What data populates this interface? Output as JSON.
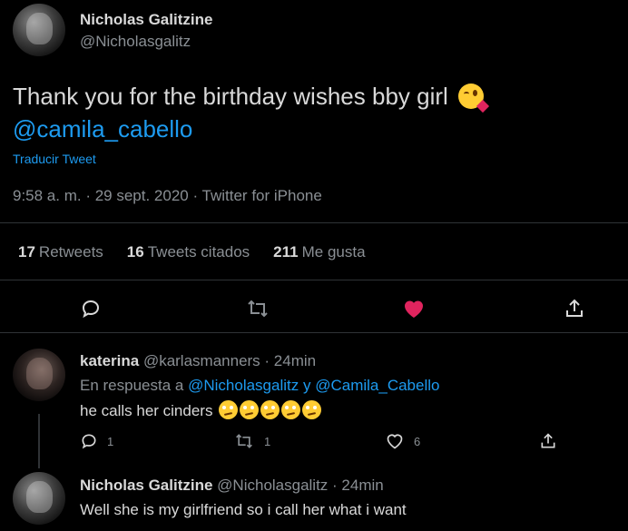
{
  "tweet": {
    "author_name": "Nicholas Galitzine",
    "author_handle": "@Nicholasgalitz",
    "text": "Thank you for the birthday wishes bby girl",
    "mention": "@camila_cabello",
    "emoji": "face-blowing-a-kiss",
    "translate_label": "Traducir Tweet",
    "timestamp": "9:58 a. m. · 29 sept. 2020 · Twitter for iPhone",
    "stats": {
      "retweets_count": "17",
      "retweets_label": "Retweets",
      "quotes_count": "16",
      "quotes_label": "Tweets citados",
      "likes_count": "211",
      "likes_label": "Me gusta"
    },
    "actions": [
      "reply-icon",
      "retweet-icon",
      "like-icon",
      "share-icon"
    ],
    "liked": true,
    "like_color": "#e0245e"
  },
  "replies": [
    {
      "author_name": "katerina",
      "author_handle": "@karlasmanners",
      "time": "· 24min",
      "in_reply_prefix": "En respuesta a",
      "in_reply_user1": "@Nicholasgalitz",
      "in_reply_and": "y",
      "in_reply_user2": "@Camila_Cabello",
      "text": "he calls her cinders",
      "emoji": "face-with-rolling-eyes",
      "emoji_count": 5,
      "reply_count": "1",
      "retweet_count": "1",
      "like_count": "6"
    },
    {
      "author_name": "Nicholas Galitzine",
      "author_handle": "@Nicholasgalitz",
      "time": "· 24min",
      "text": "Well she is my girlfriend so i call her what i want"
    }
  ],
  "colors": {
    "background": "#000000",
    "link": "#1d9bf0",
    "muted": "#8a8f94",
    "divider": "#2f3336"
  }
}
